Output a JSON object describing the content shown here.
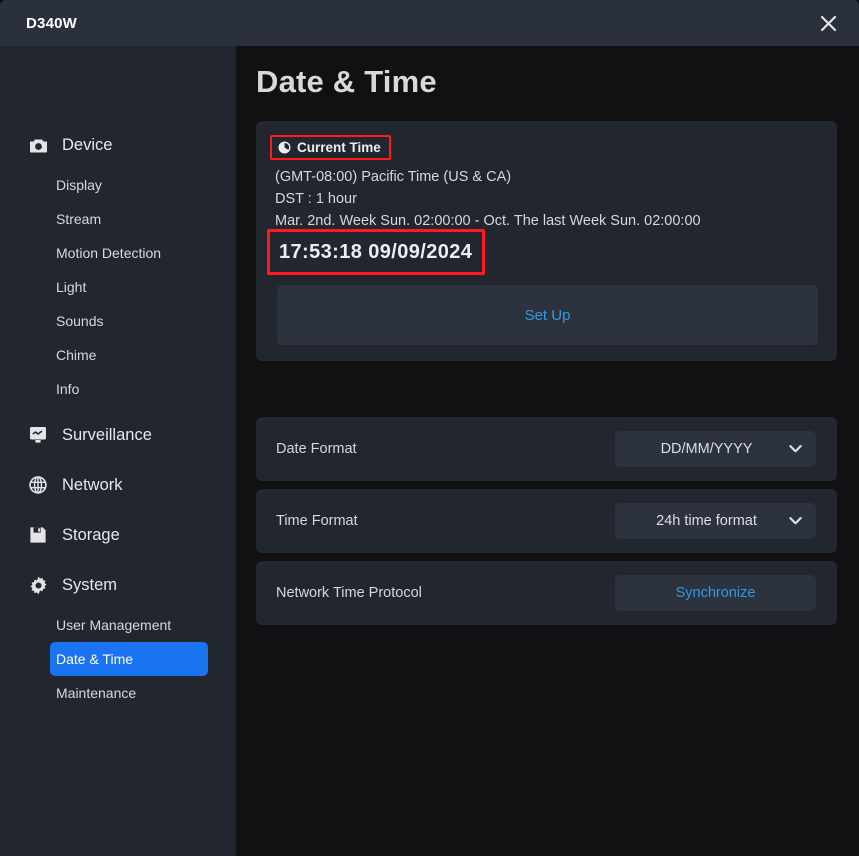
{
  "window": {
    "app_title": "D340W",
    "close_icon": "close-icon"
  },
  "sidebar": {
    "groups": [
      {
        "label": "Device",
        "icon": "camera-icon",
        "items": [
          {
            "label": "Display"
          },
          {
            "label": "Stream"
          },
          {
            "label": "Motion Detection"
          },
          {
            "label": "Light"
          },
          {
            "label": "Sounds"
          },
          {
            "label": "Chime"
          },
          {
            "label": "Info"
          }
        ]
      },
      {
        "label": "Surveillance",
        "icon": "monitor-icon",
        "items": []
      },
      {
        "label": "Network",
        "icon": "globe-icon",
        "items": []
      },
      {
        "label": "Storage",
        "icon": "floppy-disk-icon",
        "items": []
      },
      {
        "label": "System",
        "icon": "gear-icon",
        "items": [
          {
            "label": "User Management"
          },
          {
            "label": "Date & Time",
            "active": true
          },
          {
            "label": "Maintenance"
          }
        ]
      }
    ],
    "active_item": "Date & Time"
  },
  "main": {
    "page_title": "Date & Time",
    "current_time_card": {
      "badge_label": "Current Time",
      "badge_icon": "clock-icon",
      "timezone": "(GMT-08:00) Pacific Time (US & CA)",
      "dst": "DST : 1 hour",
      "dst_rule": "Mar. 2nd. Week Sun. 02:00:00 - Oct. The last Week Sun. 02:00:00",
      "clock_value": "17:53:18  09/09/2024",
      "setup_button_label": "Set Up"
    },
    "rows": [
      {
        "label": "Date Format",
        "control": "select",
        "value": "DD/MM/YYYY",
        "chevron_icon": "chevron-down-icon"
      },
      {
        "label": "Time Format",
        "control": "select",
        "value": "24h time format",
        "chevron_icon": "chevron-down-icon"
      },
      {
        "label": "Network Time Protocol",
        "control": "button",
        "value": "Synchronize"
      }
    ]
  },
  "colors": {
    "accent_blue": "#1a73f0",
    "link_blue": "#2f9ae0",
    "annotation_red": "#ff1b1b",
    "titlebar": "#2b313c",
    "sidebar": "#22262f",
    "content_bg": "#111113",
    "card_bg": "#22262f",
    "control_bg": "#2c323e"
  }
}
